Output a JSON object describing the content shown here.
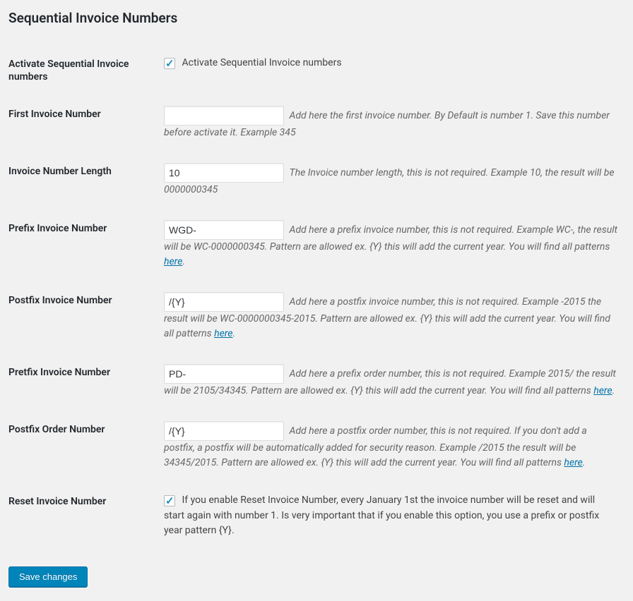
{
  "heading": "Sequential Invoice Numbers",
  "fields": {
    "activate": {
      "label": "Activate Sequential Invoice numbers",
      "checkbox_label": "Activate Sequential Invoice numbers",
      "checked": true
    },
    "first_invoice": {
      "label": "First Invoice Number",
      "value": "",
      "desc": "Add here the first invoice number. By Default is number 1. Save this number before activate it. Example 345"
    },
    "length": {
      "label": "Invoice Number Length",
      "value": "10",
      "desc": "The Invoice number length, this is not required. Example 10, the result will be 0000000345"
    },
    "prefix_invoice": {
      "label": "Prefix Invoice Number",
      "value": "WGD-",
      "desc_a": "Add here a prefix invoice number, this is not required. Example WC-, the result will be WC-0000000345. Pattern are allowed ex. {Y} this will add the current year. You will find all patterns ",
      "link": "here",
      "desc_b": "."
    },
    "postfix_invoice": {
      "label": "Postfix Invoice Number",
      "value": "/{Y}",
      "desc_a": "Add here a postfix invoice number, this is not required. Example -2015 the result will be WC-0000000345-2015. Pattern are allowed ex. {Y} this will add the current year. You will find all patterns ",
      "link": "here",
      "desc_b": "."
    },
    "pretfix_invoice": {
      "label": "Pretfix Invoice Number",
      "value": "PD-",
      "desc_a": "Add here a prefix order number, this is not required. Example 2015/ the result will be 2105/34345. Pattern are allowed ex. {Y} this will add the current year. You will find all patterns ",
      "link": "here",
      "desc_b": "."
    },
    "postfix_order": {
      "label": "Postfix Order Number",
      "value": "/{Y}",
      "desc_a": "Add here a postfix order number, this is not required. If you don't add a postfix, a postfix will be automatically added for security reason. Example /2015 the result will be 34345/2015. Pattern are allowed ex. {Y} this will add the current year. You will find all patterns ",
      "link": "here",
      "desc_b": "."
    },
    "reset": {
      "label": "Reset Invoice Number",
      "checked": true,
      "desc": "If you enable Reset Invoice Number, every January 1st the invoice number will be reset and will start again with number 1. Is very important that if you enable this option, you use a prefix or postfix year pattern {Y}."
    }
  },
  "save_button": "Save changes"
}
